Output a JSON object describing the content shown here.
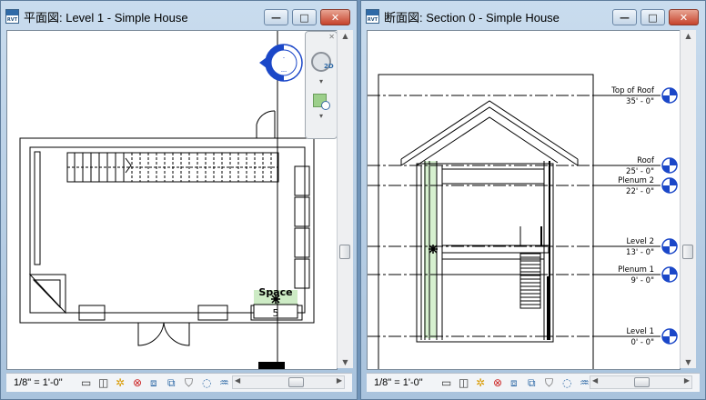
{
  "windows": [
    {
      "title": "平面図: Level 1 - Simple House",
      "app_icon_label": "RVT",
      "status": {
        "scale": "1/8\" = 1'-0\""
      },
      "room": {
        "name": "Space",
        "number": "5"
      },
      "nav": {
        "mode_label": "2D"
      }
    },
    {
      "title": "断面図: Section 0 - Simple House",
      "app_icon_label": "RVT",
      "status": {
        "scale": "1/8\" = 1'-0\""
      },
      "levels": [
        {
          "name": "Top of Roof",
          "elevation": "35' - 0\""
        },
        {
          "name": "Roof",
          "elevation": "25' - 0\""
        },
        {
          "name": "Plenum 2",
          "elevation": "22' - 0\""
        },
        {
          "name": "Level 2",
          "elevation": "13' - 0\""
        },
        {
          "name": "Plenum 1",
          "elevation": "9' - 0\""
        },
        {
          "name": "Level 1",
          "elevation": "0' - 0\""
        }
      ]
    }
  ],
  "window_buttons": {
    "minimize": "—",
    "maximize": "□",
    "close": "✕"
  },
  "status_icons": [
    "view-cube-icon",
    "visual-style-icon",
    "sun-path-icon",
    "shadows-off-icon",
    "crop-region-icon",
    "show-crop-icon",
    "temporary-hide-icon",
    "reveal-hidden-icon",
    "analysis-model-icon"
  ],
  "colors": {
    "titlebar": "#b9d1ea",
    "close": "#c6432b",
    "level_marker": "#1b47c8",
    "room_fill": "#cdebc5"
  }
}
